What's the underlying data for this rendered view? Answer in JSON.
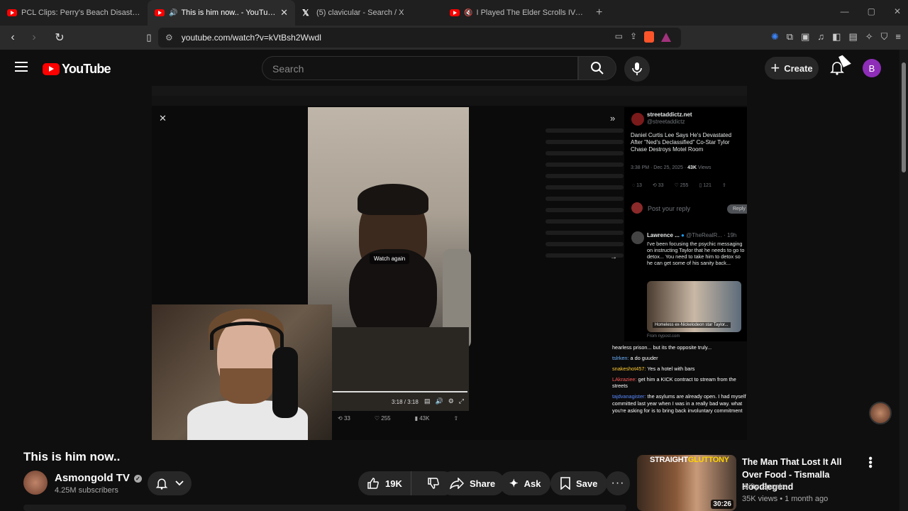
{
  "browser": {
    "tabs": [
      {
        "label": "PCL Clips: Perry's Beach Disaster - Yo",
        "icon": "youtube-icon",
        "active": false
      },
      {
        "label": "This is him now.. - YouTube",
        "icon": "youtube-icon",
        "active": true
      },
      {
        "label": "(5) clavicular - Search / X",
        "icon": "x-icon",
        "active": false
      },
      {
        "label": "I Played The Elder Scrolls IV: Obli",
        "icon": "youtube-icon",
        "active": false
      }
    ],
    "url": "youtube.com/watch?v=kVtBsh2Wwdl"
  },
  "header": {
    "logo_text": "YouTube",
    "search_placeholder": "Search",
    "create_label": "Create",
    "avatar_letter": "B",
    "avatar_color": "#8e2db8"
  },
  "player": {
    "watch_again": "Watch again",
    "video_time": "3:18 / 3:18",
    "post_stats": {
      "reposts": "33",
      "likes": "255",
      "views": "43K"
    },
    "x_post": {
      "handle_name": "streetaddictz.net",
      "handle": "@streetaddictz",
      "text": "Daniel Curtis Lee Says He's Devastated After \"Ned's Declassified\" Co-Star Tylor Chase Destroys Motel Room",
      "time": "3:38 PM · Dec 25, 2025 · ",
      "views": "43K",
      "views_suffix": " Views",
      "action_counts": {
        "replies": "13",
        "reposts": "33",
        "likes": "255",
        "bookmarks": "121"
      },
      "reply_placeholder": "Post your reply",
      "reply_button": "Reply"
    },
    "x_reply": {
      "name": "Lawrence ...",
      "handle": "@TheRealR... · 19h",
      "text": "I've been focusing the psychic messaging on instructing Taylor that he needs to go to detox... You need to take him to detox so he can get some of his sanity back...",
      "image_caption": "Homeless ex-Nickelodeon star Taylor...",
      "source": "From nypost.com"
    },
    "chat": [
      {
        "user": "",
        "text": "hearless prison... but its the opposite truly...",
        "color": "#ffffff"
      },
      {
        "user": "tslrken:",
        "text": " a do guuder",
        "color": "#6fb3ff"
      },
      {
        "user": "snakeshot457:",
        "text": " Yes a hotel with bars",
        "color": "#ffcc33"
      },
      {
        "user": "LAkraziee:",
        "text": " get him a KICK contract to stream from the streets",
        "color": "#ff5a5a"
      },
      {
        "user": "tajdvanagister:",
        "text": " the asylums are already open. I had myself committed last year when I was in a really bad way. what you're asking for is to bring back involuntary commitment",
        "color": "#5a8bff"
      }
    ]
  },
  "video": {
    "title": "This is him now..",
    "channel": "Asmongold TV",
    "subscribers": "4.25M subscribers",
    "likes": "19K",
    "share_label": "Share",
    "ask_label": "Ask",
    "save_label": "Save"
  },
  "recommended": {
    "thumb_text_white": "STRAIGHT",
    "thumb_text_yellow": "GLUTTONY",
    "duration": "30:26",
    "title": "The Man That Lost It All Over Food - Tismalla  Hoodlegend",
    "channel": "drifty Speaks",
    "meta": "35K views • 1 month ago"
  }
}
